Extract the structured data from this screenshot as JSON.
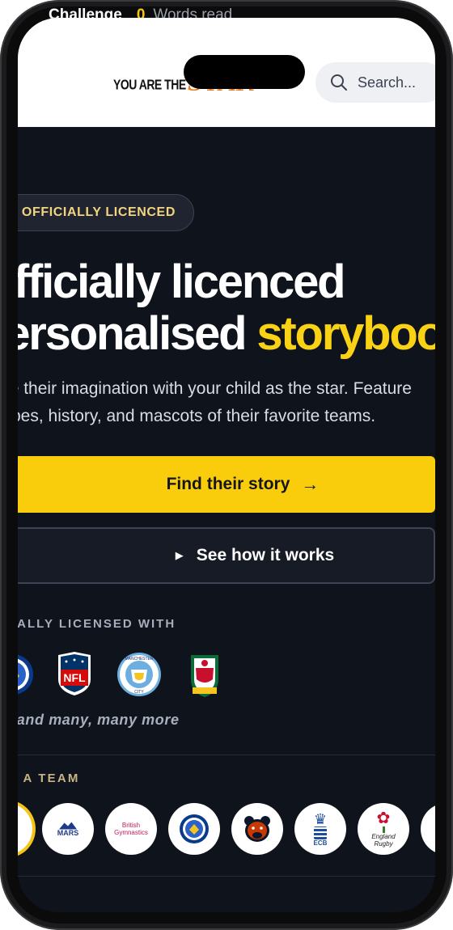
{
  "status_bar": {
    "challenge_label": "Challenge",
    "words_count": "0",
    "words_label": "Words read"
  },
  "header": {
    "logo_text": "YOU ARE THE",
    "logo_star": "STAR",
    "search_placeholder": "Search..."
  },
  "hero": {
    "badge": "OFFICIALLY LICENCED",
    "title_line1": "Officially licenced",
    "title_line2_plain": "personalised ",
    "title_line2_highlight": "storybooks",
    "subtitle_line1": "Ignite their imagination with your child as the star. Feature",
    "subtitle_line2": "stripes, history, and mascots of their favorite teams.",
    "primary_cta": "Find their story",
    "secondary_cta": "See how it works"
  },
  "licensed": {
    "label": "OFFICIALLY LICENSED WITH",
    "partners": [
      "chelsea-crest",
      "nfl-shield",
      "manchester-city-crest",
      "wrexham-crest"
    ],
    "more_text": "...and many, many more"
  },
  "teams": {
    "label": "PICK A TEAM",
    "items": [
      {
        "name": "selected-team",
        "caption": ""
      },
      {
        "name": "mars",
        "caption": "MARS"
      },
      {
        "name": "british-gymnastics",
        "caption": "British Gymnastics"
      },
      {
        "name": "chelsea",
        "caption": ""
      },
      {
        "name": "chicago-bears",
        "caption": ""
      },
      {
        "name": "ecb",
        "caption": "ECB"
      },
      {
        "name": "england-rugby",
        "caption": "England Rugby"
      },
      {
        "name": "partial-team",
        "caption": ""
      }
    ]
  },
  "colors": {
    "accent_yellow": "#f9cd0b",
    "background": "#0f131c",
    "logo_orange": "#f07a18"
  }
}
